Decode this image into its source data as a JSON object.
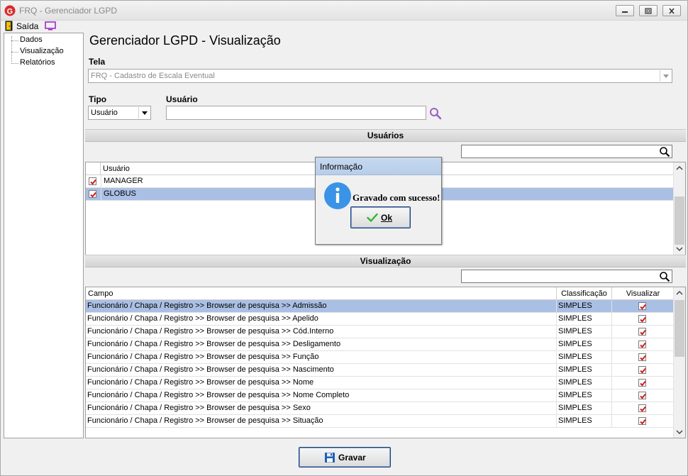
{
  "window": {
    "title": "FRQ - Gerenciador LGPD",
    "brand_color": "#d92b2b"
  },
  "menu": {
    "exit_label": "Saída"
  },
  "nav": {
    "items": [
      {
        "label": "Dados"
      },
      {
        "label": "Visualização"
      },
      {
        "label": "Relatórios"
      }
    ]
  },
  "page": {
    "title": "Gerenciador LGPD - Visualização",
    "tela_label": "Tela",
    "tela_value": "FRQ - Cadastro de Escala Eventual",
    "tipo_label": "Tipo",
    "tipo_value": "Usuário",
    "usuario_label": "Usuário",
    "usuario_value": ""
  },
  "users_section": {
    "header": "Usuários",
    "search_value": "",
    "column_header": "Usuário",
    "rows": [
      {
        "name": "MANAGER",
        "checked": true,
        "selected": false
      },
      {
        "name": "GLOBUS",
        "checked": true,
        "selected": true
      }
    ]
  },
  "visualization_section": {
    "header": "Visualização",
    "search_value": "",
    "columns": [
      "Campo",
      "Classificação",
      "Visualizar"
    ],
    "rows": [
      {
        "campo": "Funcionário / Chapa / Registro >> Browser de pesquisa >> Admissão",
        "classificacao": "SIMPLES",
        "visualizar": true,
        "selected": true
      },
      {
        "campo": "Funcionário / Chapa / Registro >> Browser de pesquisa >> Apelido",
        "classificacao": "SIMPLES",
        "visualizar": true,
        "selected": false
      },
      {
        "campo": "Funcionário / Chapa / Registro >> Browser de pesquisa >> Cód.Interno",
        "classificacao": "SIMPLES",
        "visualizar": true,
        "selected": false
      },
      {
        "campo": "Funcionário / Chapa / Registro >> Browser de pesquisa >> Desligamento",
        "classificacao": "SIMPLES",
        "visualizar": true,
        "selected": false
      },
      {
        "campo": "Funcionário / Chapa / Registro >> Browser de pesquisa >> Função",
        "classificacao": "SIMPLES",
        "visualizar": true,
        "selected": false
      },
      {
        "campo": "Funcionário / Chapa / Registro >> Browser de pesquisa >> Nascimento",
        "classificacao": "SIMPLES",
        "visualizar": true,
        "selected": false
      },
      {
        "campo": "Funcionário / Chapa / Registro >> Browser de pesquisa >> Nome",
        "classificacao": "SIMPLES",
        "visualizar": true,
        "selected": false
      },
      {
        "campo": "Funcionário / Chapa / Registro >> Browser de pesquisa >> Nome Completo",
        "classificacao": "SIMPLES",
        "visualizar": true,
        "selected": false
      },
      {
        "campo": "Funcionário / Chapa / Registro >> Browser de pesquisa >> Sexo",
        "classificacao": "SIMPLES",
        "visualizar": true,
        "selected": false
      },
      {
        "campo": "Funcionário / Chapa / Registro >> Browser de pesquisa >> Situação",
        "classificacao": "SIMPLES",
        "visualizar": true,
        "selected": false
      }
    ]
  },
  "footer": {
    "save_label": "Gravar"
  },
  "dialog": {
    "title": "Informação",
    "message": "Gravado com sucesso!",
    "ok_label": "Ok"
  },
  "colors": {
    "selection": "#aabfe4",
    "checkmark": "#cc1f1f",
    "dialog_titlebar": "#c6d9f1",
    "info_icon": "#3a93e6",
    "search_icon": "#9b5fc9"
  }
}
